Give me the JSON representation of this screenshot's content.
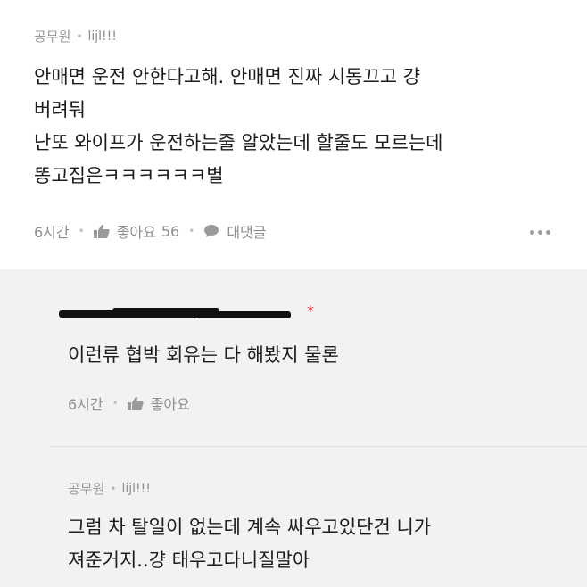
{
  "top_comment": {
    "author": "공무원",
    "user_id": "lijl!!!",
    "lines": [
      "안매면 운전 안한다고해. 안매면 진짜 시동끄고 걍",
      "버려둬",
      "난또 와이프가 운전하는줄 알았는데 할줄도 모르는데",
      "똥고집은ㅋㅋㅋㅋㅋㅋ별"
    ],
    "time": "6시간",
    "like_label": "좋아요",
    "like_count": "56",
    "reply_label": "대댓글"
  },
  "reply_1": {
    "author_redacted": true,
    "text": "이런류 협박 회유는 다 해봤지 물론",
    "time": "6시간",
    "like_label": "좋아요"
  },
  "reply_2": {
    "author": "공무원",
    "user_id": "lijl!!!",
    "lines": [
      "그럼 차 탈일이 없는데 계속 싸우고있단건 니가",
      "져준거지..걍 태우고다니질말아"
    ]
  },
  "colors": {
    "reply_background": "#f2f2f4",
    "meta_text": "#9a9a9a",
    "body_text": "#1c1c1c",
    "author_mark": "#e03131"
  },
  "icons": {
    "like": "thumbs-up-icon",
    "reply": "speech-bubble-icon",
    "more": "more-dots-icon"
  }
}
